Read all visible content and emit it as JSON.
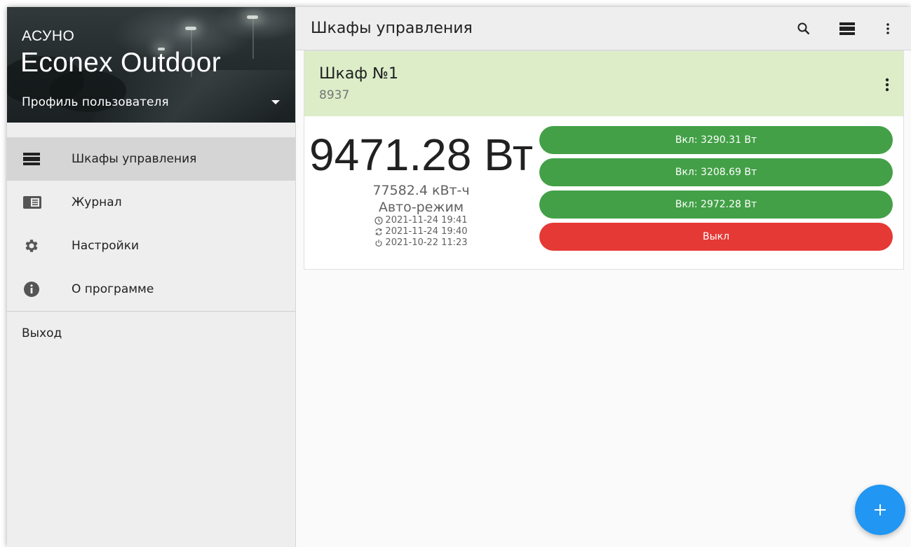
{
  "app": {
    "small_title": "АСУНО",
    "big_title": "Econex Outdoor",
    "profile_label": "Профиль пользователя"
  },
  "sidebar": {
    "items": [
      {
        "label": "Шкафы управления",
        "icon": "cabinet-list-icon",
        "active": true
      },
      {
        "label": "Журнал",
        "icon": "journal-icon",
        "active": false
      },
      {
        "label": "Настройки",
        "icon": "gear-icon",
        "active": false
      },
      {
        "label": "О программе",
        "icon": "info-icon",
        "active": false
      }
    ],
    "logout_label": "Выход"
  },
  "toolbar": {
    "title": "Шкафы управления",
    "icons": [
      "search-icon",
      "view-list-icon",
      "more-vert-icon"
    ]
  },
  "cabinet": {
    "title": "Шкаф №1",
    "subtitle": "8937",
    "power": "9471.28 Вт",
    "energy": "77582.4 кВт-ч",
    "mode": "Авто-режим",
    "times": [
      {
        "icon": "clock-icon",
        "value": "2021-11-24 19:41"
      },
      {
        "icon": "sync-icon",
        "value": "2021-11-24 19:40"
      },
      {
        "icon": "power-icon",
        "value": "2021-10-22 11:23"
      }
    ],
    "channels": [
      {
        "label": "Вкл: 3290.31 Вт",
        "state": "on"
      },
      {
        "label": "Вкл: 3208.69 Вт",
        "state": "on"
      },
      {
        "label": "Вкл: 2972.28 Вт",
        "state": "on"
      },
      {
        "label": "Выкл",
        "state": "off"
      }
    ],
    "colors": {
      "header": "#dcedc8",
      "on": "#43a047",
      "off": "#e53935"
    }
  },
  "fab": {
    "icon": "plus-icon",
    "color": "#2196f3"
  }
}
